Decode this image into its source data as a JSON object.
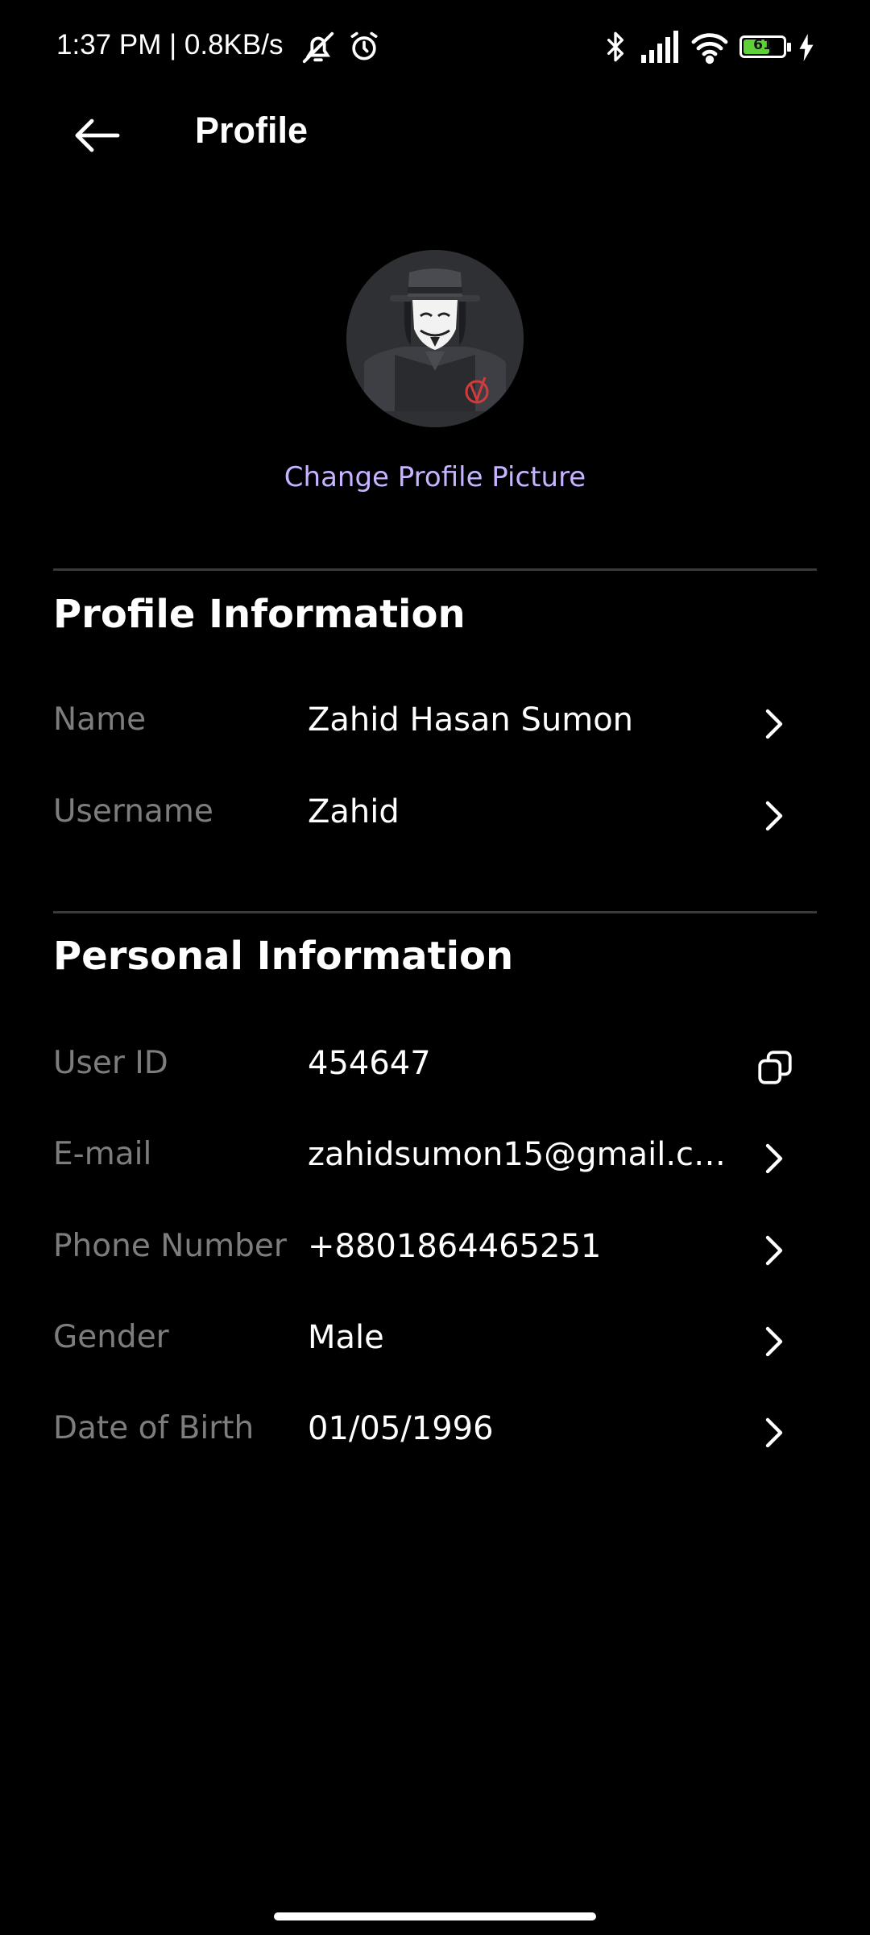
{
  "status_bar": {
    "time_text": "1:37 PM | 0.8KB/s",
    "battery_level": "61",
    "icons": [
      "mute-icon",
      "alarm-icon",
      "bluetooth-icon",
      "signal-icon",
      "wifi-icon",
      "battery-icon",
      "charging-icon"
    ]
  },
  "app_bar": {
    "title": "Profile",
    "back_icon": "arrow-left-icon"
  },
  "avatar": {
    "action_label": "Change Profile Picture",
    "accent_color": "#c7b3ff"
  },
  "profile_section": {
    "title": "Profile Information",
    "rows": [
      {
        "label": "Name",
        "value": "Zahid Hasan Sumon",
        "action_icon": "chevron-right-icon"
      },
      {
        "label": "Username",
        "value": "Zahid",
        "action_icon": "chevron-right-icon"
      }
    ]
  },
  "personal_section": {
    "title": "Personal Information",
    "rows": [
      {
        "label": "User ID",
        "value": "454647",
        "action_icon": "copy-icon"
      },
      {
        "label": "E-mail",
        "value": "zahidsumon15@gmail.co...",
        "action_icon": "chevron-right-icon"
      },
      {
        "label": "Phone Number",
        "value": "+8801864465251",
        "action_icon": "chevron-right-icon"
      },
      {
        "label": "Gender",
        "value": "Male",
        "action_icon": "chevron-right-icon"
      },
      {
        "label": "Date of Birth",
        "value": "01/05/1996",
        "action_icon": "chevron-right-icon"
      }
    ]
  },
  "colors": {
    "background": "#000000",
    "label_gray": "#7d7d7d",
    "divider": "#3a3a3a"
  }
}
